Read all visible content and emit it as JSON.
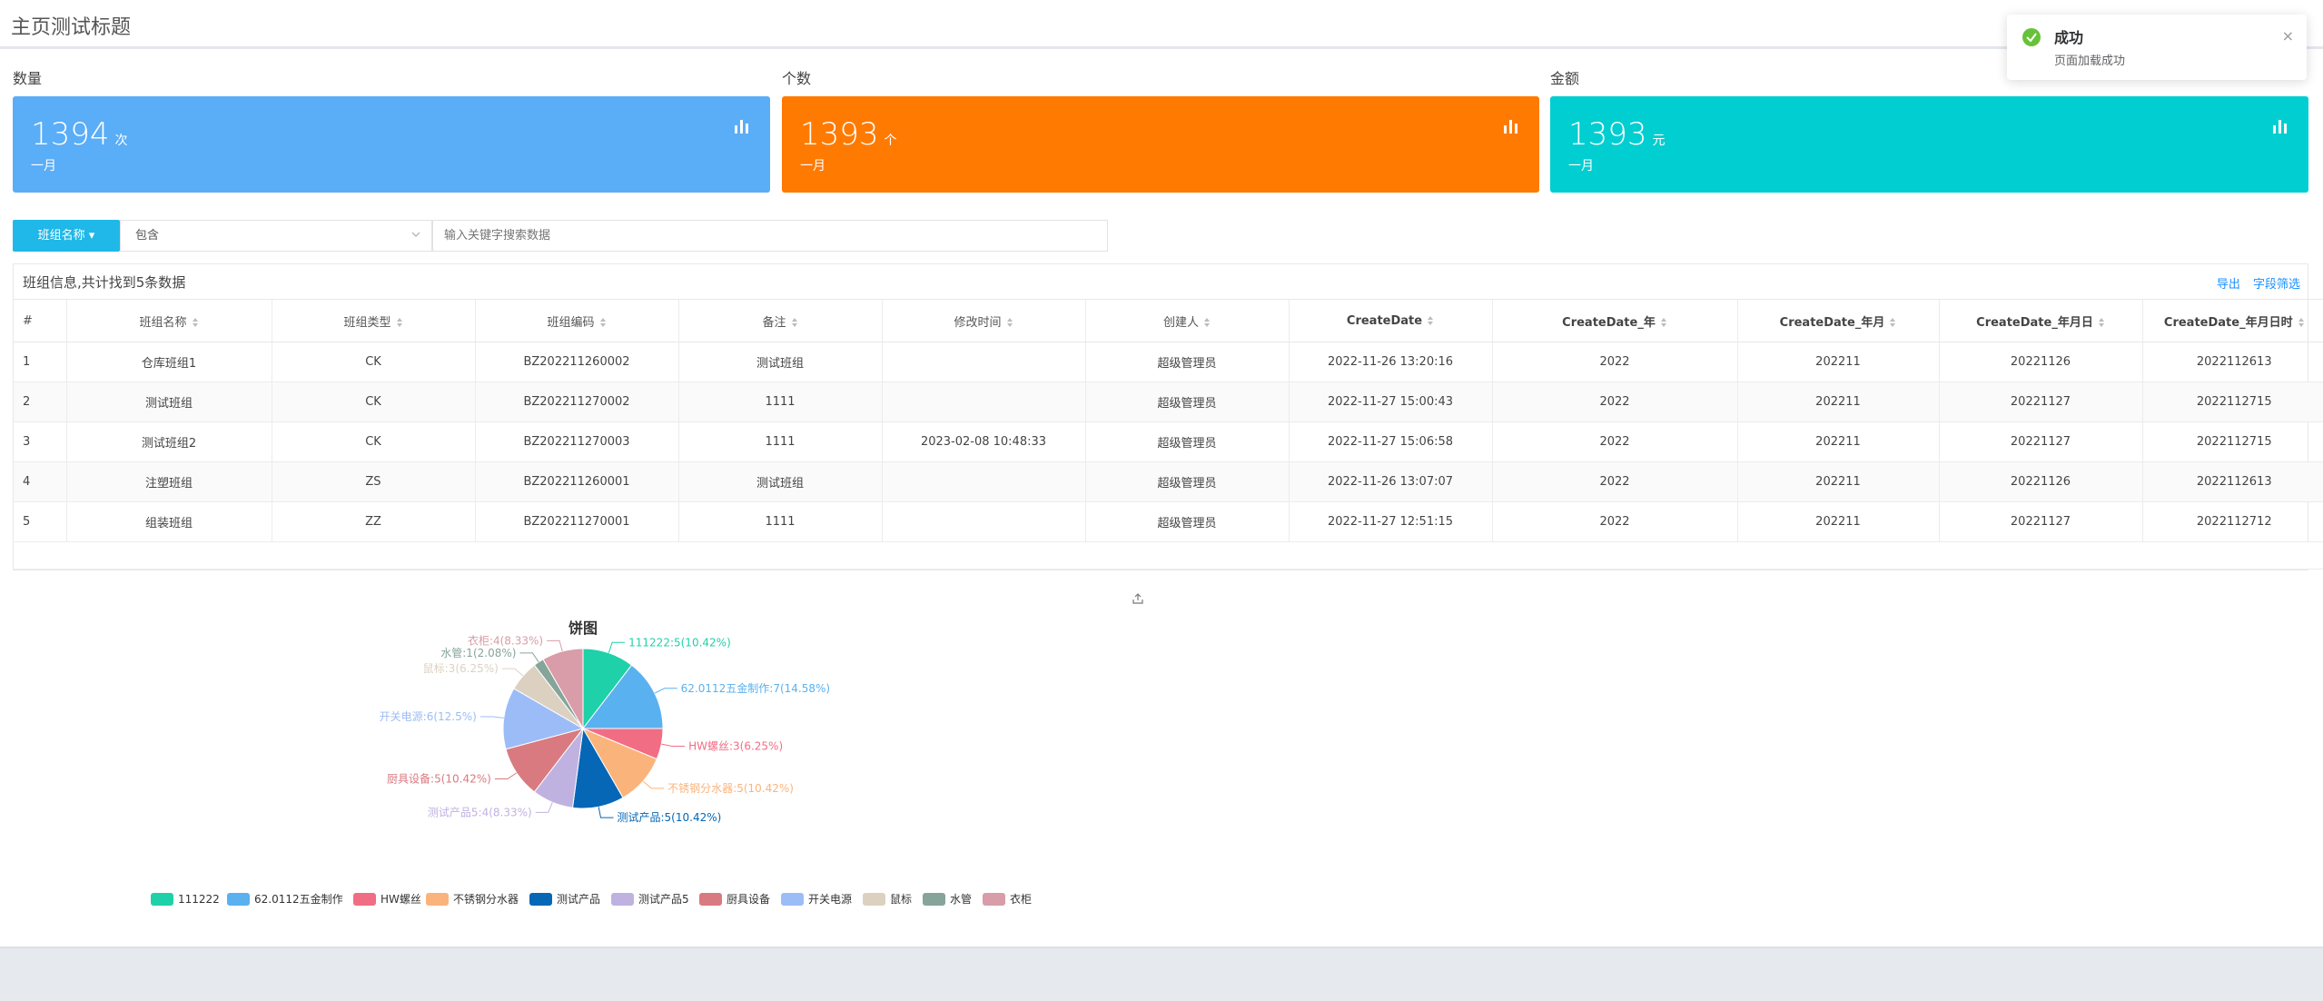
{
  "header": {
    "title": "主页测试标题"
  },
  "cards": [
    {
      "label": "数量",
      "value": "1394",
      "unit": "次",
      "period": "一月",
      "color": "#5aadf7",
      "icon": "bar-chart-icon"
    },
    {
      "label": "个数",
      "value": "1393",
      "unit": "个",
      "period": "一月",
      "color": "#ff7a00",
      "icon": "bar-chart-icon"
    },
    {
      "label": "金额",
      "value": "1393",
      "unit": "元",
      "period": "一月",
      "color": "#00ced1",
      "icon": "bar-chart-icon"
    }
  ],
  "filter": {
    "field_button": "班组名称 ▾",
    "operator": "包含",
    "search_placeholder": "输入关键字搜索数据"
  },
  "table": {
    "caption": "班组信息,共计找到5条数据",
    "export_label": "导出",
    "field_filter_label": "字段筛选",
    "columns": [
      "#",
      "班组名称",
      "班组类型",
      "班组编码",
      "备注",
      "修改时间",
      "创建人",
      "CreateDate",
      "CreateDate_年",
      "CreateDate_年月",
      "CreateDate_年月日",
      "CreateDate_年月日时"
    ],
    "rows": [
      [
        "1",
        "仓库班组1",
        "CK",
        "BZ202211260002",
        "测试班组",
        "",
        "超级管理员",
        "2022-11-26 13:20:16",
        "2022",
        "202211",
        "20221126",
        "2022112613"
      ],
      [
        "2",
        "测试班组",
        "CK",
        "BZ202211270002",
        "1111",
        "",
        "超级管理员",
        "2022-11-27 15:00:43",
        "2022",
        "202211",
        "20221127",
        "2022112715"
      ],
      [
        "3",
        "测试班组2",
        "CK",
        "BZ202211270003",
        "1111",
        "2023-02-08 10:48:33",
        "超级管理员",
        "2022-11-27 15:06:58",
        "2022",
        "202211",
        "20221127",
        "2022112715"
      ],
      [
        "4",
        "注塑班组",
        "ZS",
        "BZ202211260001",
        "测试班组",
        "",
        "超级管理员",
        "2022-11-26 13:07:07",
        "2022",
        "202211",
        "20221126",
        "2022112613"
      ],
      [
        "5",
        "组装班组",
        "ZZ",
        "BZ202211270001",
        "1111",
        "",
        "超级管理员",
        "2022-11-27 12:51:15",
        "2022",
        "202211",
        "20221127",
        "2022112712"
      ]
    ]
  },
  "notification": {
    "title": "成功",
    "message": "页面加载成功",
    "close": "×"
  },
  "chart_data": {
    "type": "pie",
    "title": "饼图",
    "legend_position": "bottom",
    "slices": [
      {
        "name": "111222",
        "value": 5,
        "percent": "10.42%",
        "label": "111222:5(10.42%)",
        "color": "#1fd1a8"
      },
      {
        "name": "62.0112五金制作",
        "value": 7,
        "percent": "14.58%",
        "label": "62.0112五金制作:7(14.58%)",
        "color": "#5ab1ef"
      },
      {
        "name": "HW螺丝",
        "value": 3,
        "percent": "6.25%",
        "label": "HW螺丝:3(6.25%)",
        "color": "#f16d84"
      },
      {
        "name": "不锈钢分水器",
        "value": 5,
        "percent": "10.42%",
        "label": "不锈钢分水器:5(10.42%)",
        "color": "#fbb37c"
      },
      {
        "name": "测试产品",
        "value": 5,
        "percent": "10.42%",
        "label": "测试产品:5(10.42%)",
        "color": "#0567b5"
      },
      {
        "name": "测试产品5",
        "value": 4,
        "percent": "8.33%",
        "label": "测试产品5:4(8.33%)",
        "color": "#c0b2e0"
      },
      {
        "name": "厨具设备",
        "value": 5,
        "percent": "10.42%",
        "label": "厨具设备:5(10.42%)",
        "color": "#d97a80"
      },
      {
        "name": "开关电源",
        "value": 6,
        "percent": "12.5%",
        "label": "开关电源:6(12.5%)",
        "color": "#9cbcf7"
      },
      {
        "name": "鼠标",
        "value": 3,
        "percent": "6.25%",
        "label": "鼠标:3(6.25%)",
        "color": "#dcd1c1"
      },
      {
        "name": "水管",
        "value": 1,
        "percent": "2.08%",
        "label": "水管:1(2.08%)",
        "color": "#86a49a"
      },
      {
        "name": "衣柜",
        "value": 4,
        "percent": "8.33%",
        "label": "衣柜:4(8.33%)",
        "color": "#d89da8"
      }
    ]
  }
}
